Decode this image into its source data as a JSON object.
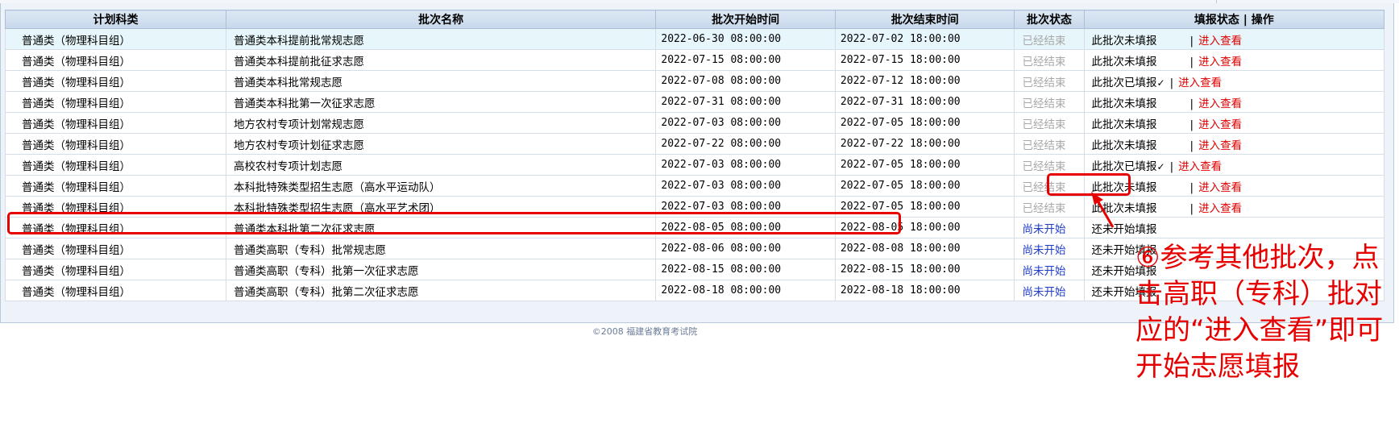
{
  "table": {
    "headers": {
      "category": "计划科类",
      "batch_name": "批次名称",
      "start_time": "批次开始时间",
      "end_time": "批次结束时间",
      "batch_status": "批次状态",
      "fill_status": "填报状态 | 操作"
    },
    "separator": "|",
    "action_label": "进入查看",
    "rows": [
      {
        "category": "普通类（物理科目组）",
        "name": "普通类本科提前批常规志愿",
        "start": "2022-06-30 08:00:00",
        "end": "2022-07-02 18:00:00",
        "status": "已经结束",
        "fill": "此批次未填报",
        "has_action": true
      },
      {
        "category": "普通类（物理科目组）",
        "name": "普通类本科提前批征求志愿",
        "start": "2022-07-15 08:00:00",
        "end": "2022-07-15 18:00:00",
        "status": "已经结束",
        "fill": "此批次未填报",
        "has_action": true
      },
      {
        "category": "普通类（物理科目组）",
        "name": "普通类本科批常规志愿",
        "start": "2022-07-08 08:00:00",
        "end": "2022-07-12 18:00:00",
        "status": "已经结束",
        "fill": "此批次已填报",
        "filled": true,
        "has_action": true
      },
      {
        "category": "普通类（物理科目组）",
        "name": "普通类本科批第一次征求志愿",
        "start": "2022-07-31 08:00:00",
        "end": "2022-07-31 18:00:00",
        "status": "已经结束",
        "fill": "此批次未填报",
        "has_action": true
      },
      {
        "category": "普通类（物理科目组）",
        "name": "地方农村专项计划常规志愿",
        "start": "2022-07-03 08:00:00",
        "end": "2022-07-05 18:00:00",
        "status": "已经结束",
        "fill": "此批次未填报",
        "has_action": true
      },
      {
        "category": "普通类（物理科目组）",
        "name": "地方农村专项计划征求志愿",
        "start": "2022-07-22 08:00:00",
        "end": "2022-07-22 18:00:00",
        "status": "已经结束",
        "fill": "此批次未填报",
        "has_action": true
      },
      {
        "category": "普通类（物理科目组）",
        "name": "高校农村专项计划志愿",
        "start": "2022-07-03 08:00:00",
        "end": "2022-07-05 18:00:00",
        "status": "已经结束",
        "fill": "此批次已填报",
        "filled": true,
        "has_action": true
      },
      {
        "category": "普通类（物理科目组）",
        "name": "本科批特殊类型招生志愿（高水平运动队）",
        "start": "2022-07-03 08:00:00",
        "end": "2022-07-05 18:00:00",
        "status": "已经结束",
        "fill": "此批次未填报",
        "has_action": true
      },
      {
        "category": "普通类（物理科目组）",
        "name": "本科批特殊类型招生志愿（高水平艺术团）",
        "start": "2022-07-03 08:00:00",
        "end": "2022-07-05 18:00:00",
        "status": "已经结束",
        "fill": "此批次未填报",
        "has_action": true
      },
      {
        "category": "普通类（物理科目组）",
        "name": "普通类本科批第二次征求志愿",
        "start": "2022-08-05 08:00:00",
        "end": "2022-08-05 18:00:00",
        "status": "尚未开始",
        "fill": "还未开始填报",
        "has_action": false
      },
      {
        "category": "普通类（物理科目组）",
        "name": "普通类高职（专科）批常规志愿",
        "start": "2022-08-06 08:00:00",
        "end": "2022-08-08 18:00:00",
        "status": "尚未开始",
        "fill": "还未开始填报",
        "has_action": false
      },
      {
        "category": "普通类（物理科目组）",
        "name": "普通类高职（专科）批第一次征求志愿",
        "start": "2022-08-15 08:00:00",
        "end": "2022-08-15 18:00:00",
        "status": "尚未开始",
        "fill": "还未开始填报",
        "has_action": false
      },
      {
        "category": "普通类（物理科目组）",
        "name": "普通类高职（专科）批第二次征求志愿",
        "start": "2022-08-18 08:00:00",
        "end": "2022-08-18 18:00:00",
        "status": "尚未开始",
        "fill": "还未开始填报",
        "has_action": false
      }
    ]
  },
  "footer": "©2008 福建省教育考试院",
  "annotation": {
    "text": "⑥参考其他批次，点击高职（专科）批对应的“进入查看”即可开始志愿填报",
    "color": "#e60000"
  },
  "colors": {
    "ended": "#a8a8a8",
    "pending": "#1f3cc8",
    "action": "#e00000",
    "highlight_row": "#e6f6fb"
  }
}
